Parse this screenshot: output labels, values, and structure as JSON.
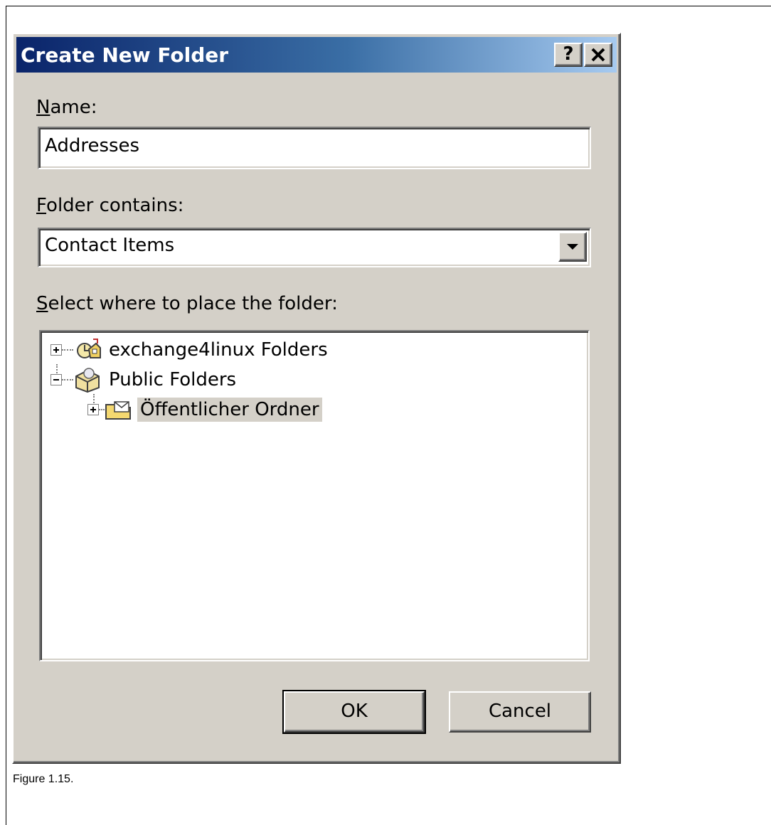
{
  "dialog": {
    "title": "Create New Folder",
    "help_label": "?",
    "close_label": "✕"
  },
  "name_field": {
    "label_mnemonic": "N",
    "label_rest": "ame:",
    "value": "Addresses"
  },
  "contains_field": {
    "label_mnemonic": "F",
    "label_rest": "older contains:",
    "value": "Contact Items"
  },
  "location": {
    "label_mnemonic": "S",
    "label_rest": "elect where to place the folder:",
    "tree": [
      {
        "label": "exchange4linux Folders",
        "icon": "mailbox-icon",
        "expander": "plus"
      },
      {
        "label": "Public Folders",
        "icon": "public-folders-icon",
        "expander": "minus"
      },
      {
        "label": "Öffentlicher Ordner",
        "icon": "mail-folder-icon",
        "expander": "plus",
        "selected": true
      }
    ]
  },
  "buttons": {
    "ok": "OK",
    "cancel": "Cancel"
  },
  "caption": "Figure 1.15.",
  "colors": {
    "dialog_bg": "#d4d0c8",
    "title_start": "#0a246a",
    "title_end": "#a6caf0"
  }
}
